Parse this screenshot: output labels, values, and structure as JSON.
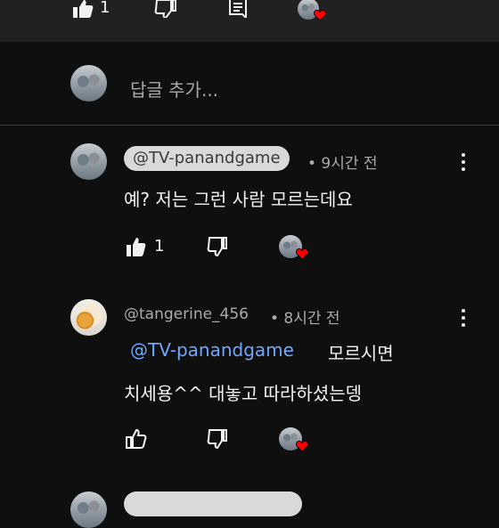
{
  "top_actions": {
    "like_count": "1"
  },
  "reply_box": {
    "placeholder": "답글 추가..."
  },
  "comments": [
    {
      "handle": "@TV-panandgame",
      "time": "• 9시간 전",
      "text": "예? 저는 그런 사람 모르는데요",
      "like_count": "1"
    },
    {
      "handle": "@tangerine_456",
      "time": "• 8시간 전",
      "mention": "@TV-panandgame",
      "text_after_mention": "모르시면",
      "text_line2": "치세용^^ 대놓고 따라하셨는뎅",
      "like_count": ""
    }
  ],
  "colors": {
    "background": "#0f0f0f",
    "mention": "#6ea8fe",
    "heart": "#ff0000",
    "chip": "#d9d9d9"
  }
}
